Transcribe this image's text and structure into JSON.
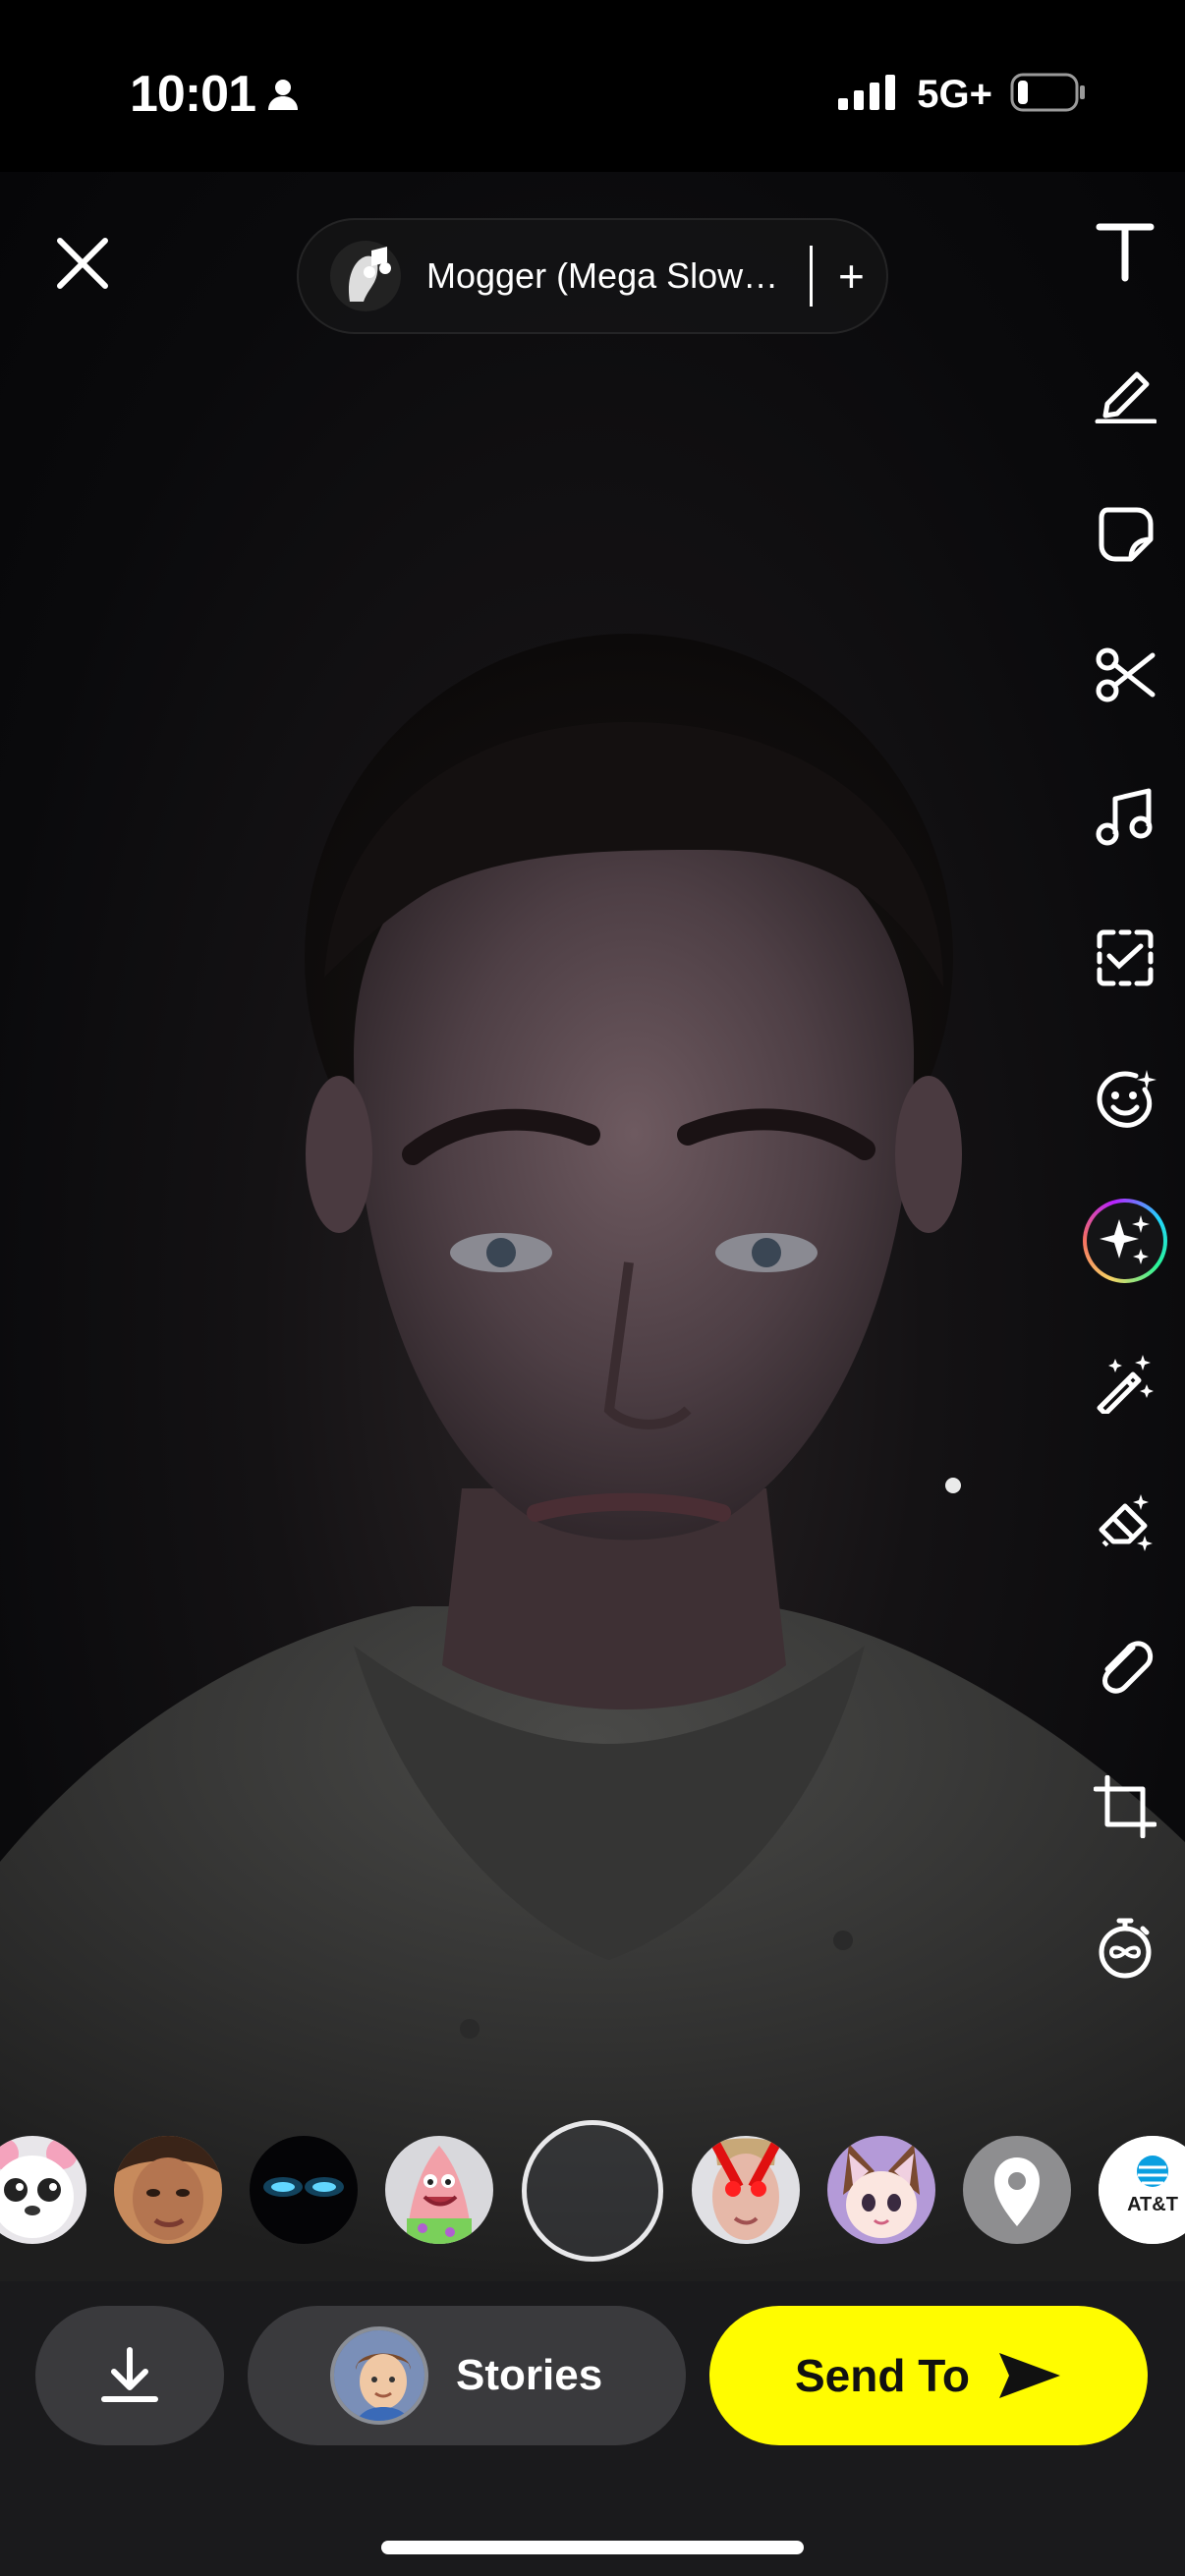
{
  "status_bar": {
    "time": "10:01",
    "network": "5G+",
    "battery_level": 0.15,
    "signal_bars": 4
  },
  "top_bar": {
    "close_icon": "close-icon",
    "music": {
      "title": "Mogger (Mega Slow…",
      "add_label": "+"
    }
  },
  "tools": [
    {
      "name": "text",
      "icon": "text-icon"
    },
    {
      "name": "draw",
      "icon": "pencil-icon"
    },
    {
      "name": "stickers",
      "icon": "sticker-icon"
    },
    {
      "name": "scissors",
      "icon": "scissors-icon"
    },
    {
      "name": "music",
      "icon": "music-note-icon"
    },
    {
      "name": "scan",
      "icon": "scan-icon"
    },
    {
      "name": "lenses",
      "icon": "smiley-sparkle-icon"
    },
    {
      "name": "ai-magic",
      "icon": "sparkles-icon"
    },
    {
      "name": "magic-wand",
      "icon": "magic-wand-icon"
    },
    {
      "name": "eraser",
      "icon": "magic-eraser-icon"
    },
    {
      "name": "attach",
      "icon": "paperclip-icon"
    },
    {
      "name": "crop",
      "icon": "crop-icon"
    },
    {
      "name": "timer",
      "icon": "loop-timer-icon"
    }
  ],
  "lenses": [
    {
      "name": "white-animal-lens"
    },
    {
      "name": "face-lens"
    },
    {
      "name": "glowing-eyes-lens"
    },
    {
      "name": "patrick-lens"
    },
    {
      "name": "capture-button"
    },
    {
      "name": "red-eyes-lens"
    },
    {
      "name": "cat-ears-lens"
    },
    {
      "name": "location-lens"
    },
    {
      "name": "att-lens",
      "label": "AT&T"
    }
  ],
  "bottom_bar": {
    "save_icon": "download-icon",
    "stories_label": "Stories",
    "send_label": "Send To",
    "accent_color": "#FFFC00"
  }
}
